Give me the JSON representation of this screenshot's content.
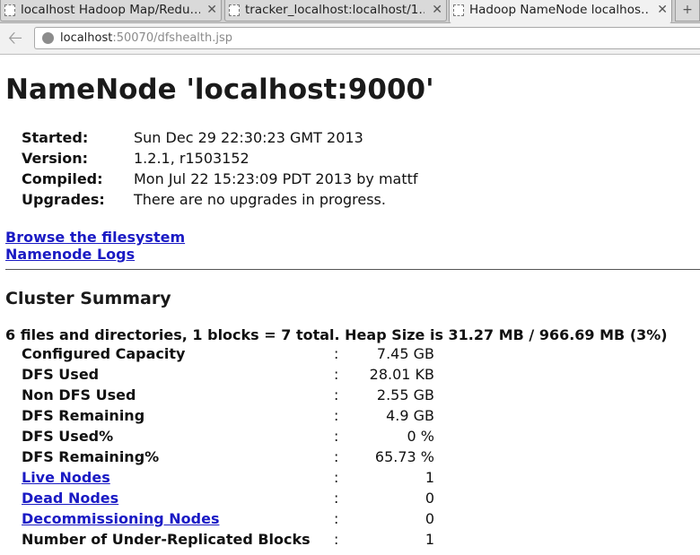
{
  "browser": {
    "tabs": [
      {
        "title": "localhost Hadoop Map/Redu…",
        "active": false
      },
      {
        "title": "tracker_localhost:localhost/1…",
        "active": false
      },
      {
        "title": "Hadoop NameNode localhos…",
        "active": true
      }
    ],
    "close_glyph": "✕",
    "new_tab_glyph": "+",
    "url_host": "localhost",
    "url_rest": ":50070/dfshealth.jsp"
  },
  "page": {
    "title": "NameNode 'localhost:9000'",
    "info": [
      {
        "key": "Started:",
        "value": "Sun Dec 29 22:30:23 GMT 2013"
      },
      {
        "key": "Version:",
        "value": "1.2.1, r1503152"
      },
      {
        "key": "Compiled:",
        "value": "Mon Jul 22 15:23:09 PDT 2013 by mattf"
      },
      {
        "key": "Upgrades:",
        "value": "There are no upgrades in progress."
      }
    ],
    "links": {
      "browse": "Browse the filesystem",
      "logs": "Namenode Logs"
    },
    "cluster_heading": "Cluster Summary",
    "summary_line": "6 files and directories, 1 blocks = 7 total. Heap Size is 31.27 MB / 966.69 MB (3%)",
    "stats": [
      {
        "label": "Configured Capacity",
        "value": "7.45 GB",
        "link": false
      },
      {
        "label": "DFS Used",
        "value": "28.01 KB",
        "link": false
      },
      {
        "label": "Non DFS Used",
        "value": "2.55 GB",
        "link": false
      },
      {
        "label": "DFS Remaining",
        "value": "4.9 GB",
        "link": false
      },
      {
        "label": "DFS Used%",
        "value": "0 %",
        "link": false
      },
      {
        "label": "DFS Remaining%",
        "value": "65.73 %",
        "link": false
      },
      {
        "label": "Live Nodes",
        "value": "1",
        "link": true
      },
      {
        "label": "Dead Nodes",
        "value": "0",
        "link": true
      },
      {
        "label": "Decommissioning Nodes",
        "value": "0",
        "link": true
      },
      {
        "label": "Number of Under-Replicated Blocks",
        "value": "1",
        "link": false
      }
    ],
    "colon": ":"
  },
  "colors": {
    "link": "#1a1ac4",
    "tabbar": "#cfcfcf",
    "toolbar": "#f1f1f1"
  }
}
